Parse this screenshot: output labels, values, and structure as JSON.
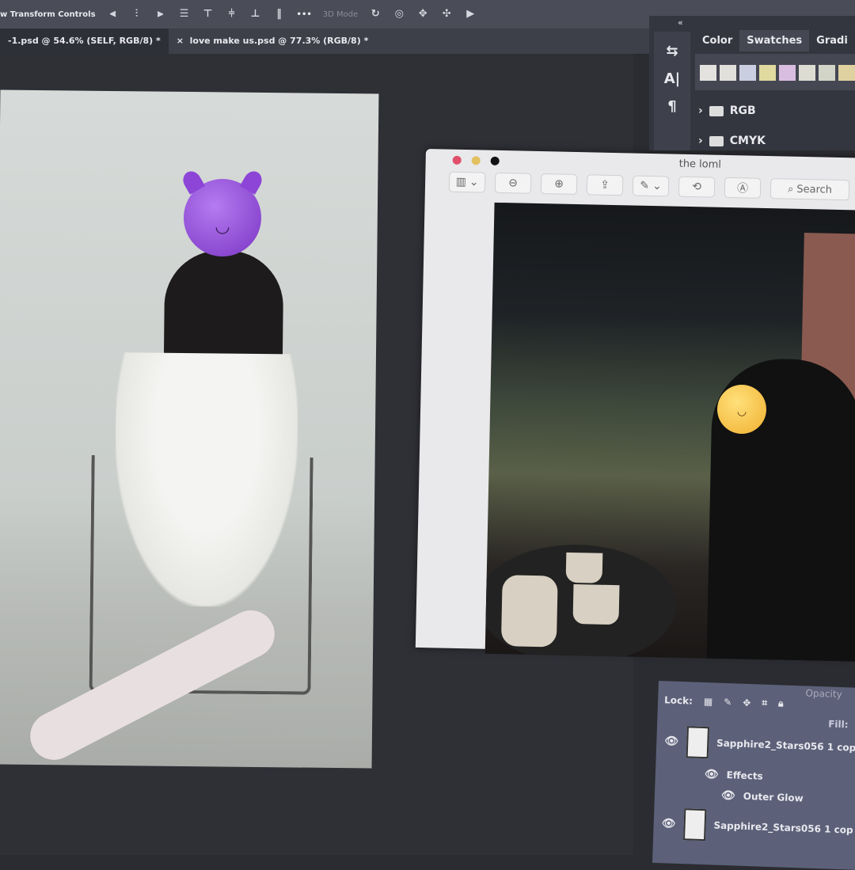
{
  "toolbar": {
    "transform_label": "w Transform Controls",
    "more": "•••",
    "mode_label": "3D Mode"
  },
  "tabs": [
    {
      "label": "-1.psd @ 54.6% (SELF, RGB/8) *"
    },
    {
      "label": "love make us.psd @ 77.3% (RGB/8) *",
      "close": "×"
    }
  ],
  "preview": {
    "title": "the loml",
    "search_placeholder": "Search"
  },
  "panel": {
    "collapse": "«",
    "tabs": [
      "Color",
      "Swatches",
      "Gradi"
    ],
    "swatch_colors": [
      "#e4e2df",
      "#e2e0da",
      "#c9cee0",
      "#e0d9a0",
      "#d9bde0",
      "#dcdcd2",
      "#d2d4c8",
      "#e0d2a0"
    ],
    "groups": [
      "RGB",
      "CMYK"
    ]
  },
  "layers": {
    "lock_label": "Lock:",
    "opacity_label": "Opacity",
    "fill_label": "Fill:",
    "items": [
      {
        "name": "Sapphire2_Stars056 1 cop"
      },
      {
        "name": "Effects"
      },
      {
        "name": "Outer Glow"
      },
      {
        "name": "Sapphire2_Stars056 1 cop"
      }
    ]
  }
}
